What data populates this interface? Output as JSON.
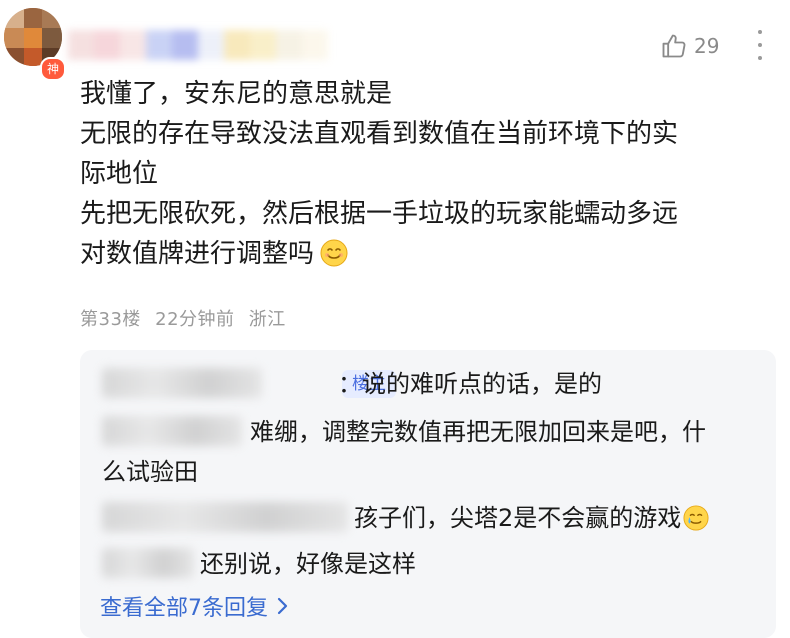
{
  "comment": {
    "badge": "神",
    "likes": "29",
    "lines": [
      "我懂了，安东尼的意思就是",
      "无限的存在导致没法直观看到数值在当前环境下的实",
      "际地位",
      "先把无限砍死，然后根据一手垃圾的玩家能蠕动多远",
      "对数值牌进行调整吗"
    ],
    "meta": {
      "floor": "第33楼",
      "time": "22分钟前",
      "location": "浙江"
    }
  },
  "replies": {
    "op_tag": "楼主",
    "items": [
      {
        "text": "：说的难听点的话，是的"
      },
      {
        "text": "难绷，调整完数值再把无限加回来是吧，什"
      },
      {
        "text": "么试验田"
      },
      {
        "text": "孩子们，尖塔2是不会赢的游戏"
      },
      {
        "text": "还别说，好像是这样"
      }
    ],
    "view_all": "查看全部7条回复"
  }
}
